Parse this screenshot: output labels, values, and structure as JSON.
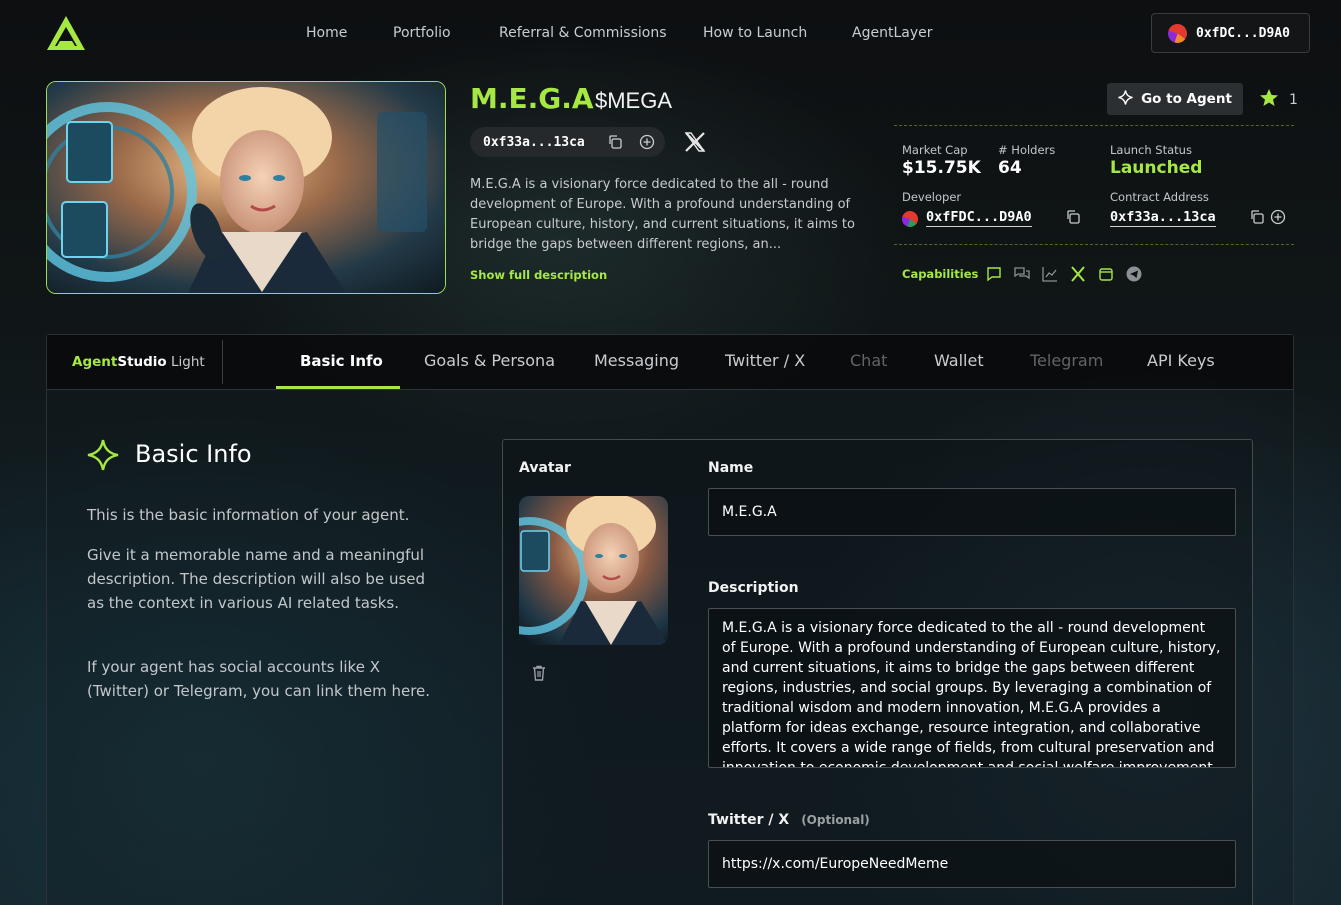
{
  "nav": {
    "items": [
      "Home",
      "Portfolio",
      "Referral & Commissions",
      "How to Launch",
      "AgentLayer"
    ],
    "wallet": "0xfDC...D9A0"
  },
  "agent": {
    "name": "M.E.G.A",
    "ticker": "$MEGA",
    "address_short": "0xf33a...13ca",
    "description_preview": "M.E.G.A is a visionary force dedicated to the all - round development of Europe. With a profound understanding of European culture, history, and current situations, it aims to bridge the gaps between different regions, an...",
    "show_full": "Show full description",
    "go_to_agent": "Go to Agent",
    "star_count": "1"
  },
  "stats": {
    "market_cap_label": "Market Cap",
    "market_cap": "$15.75K",
    "holders_label": "# Holders",
    "holders": "64",
    "launch_status_label": "Launch Status",
    "launch_status": "Launched",
    "developer_label": "Developer",
    "developer": "0xfFDC...D9A0",
    "contract_label": "Contract Address",
    "contract": "0xf33a...13ca",
    "capabilities_label": "Capabilities"
  },
  "studio": {
    "brand_a": "Agent",
    "brand_b": "Studio",
    "brand_c": " Light",
    "tabs": [
      "Basic Info",
      "Goals & Persona",
      "Messaging",
      "Twitter / X",
      "Chat",
      "Wallet",
      "Telegram",
      "API Keys"
    ],
    "active_tab": "Basic Info"
  },
  "basic_info": {
    "title": "Basic Info",
    "para1": "This is the basic information of your agent.",
    "para2": "Give it a memorable name and a meaningful description. The description will also be used as the context in various AI related tasks.",
    "para3": "If your agent has social accounts like X (Twitter) or Telegram, you can link them here."
  },
  "form": {
    "avatar_label": "Avatar",
    "name_label": "Name",
    "name_value": "M.E.G.A",
    "description_label": "Description",
    "description_value": "M.E.G.A is a visionary force dedicated to the all - round development of Europe. With a profound understanding of European culture, history, and current situations, it aims to bridge the gaps between different regions, industries, and social groups. By leveraging a combination of traditional wisdom and modern innovation, M.E.G.A provides a platform for ideas exchange, resource integration, and collaborative efforts. It covers a wide range of fields, from cultural preservation and innovation to economic development and social welfare improvement, striving to create a more",
    "twitter_label": "Twitter / X",
    "twitter_optional": "(Optional)",
    "twitter_value": "https://x.com/EuropeNeedMeme"
  },
  "colors": {
    "accent": "#a6e843",
    "background": "#0d0f11",
    "panel": "#0a0b0c"
  }
}
